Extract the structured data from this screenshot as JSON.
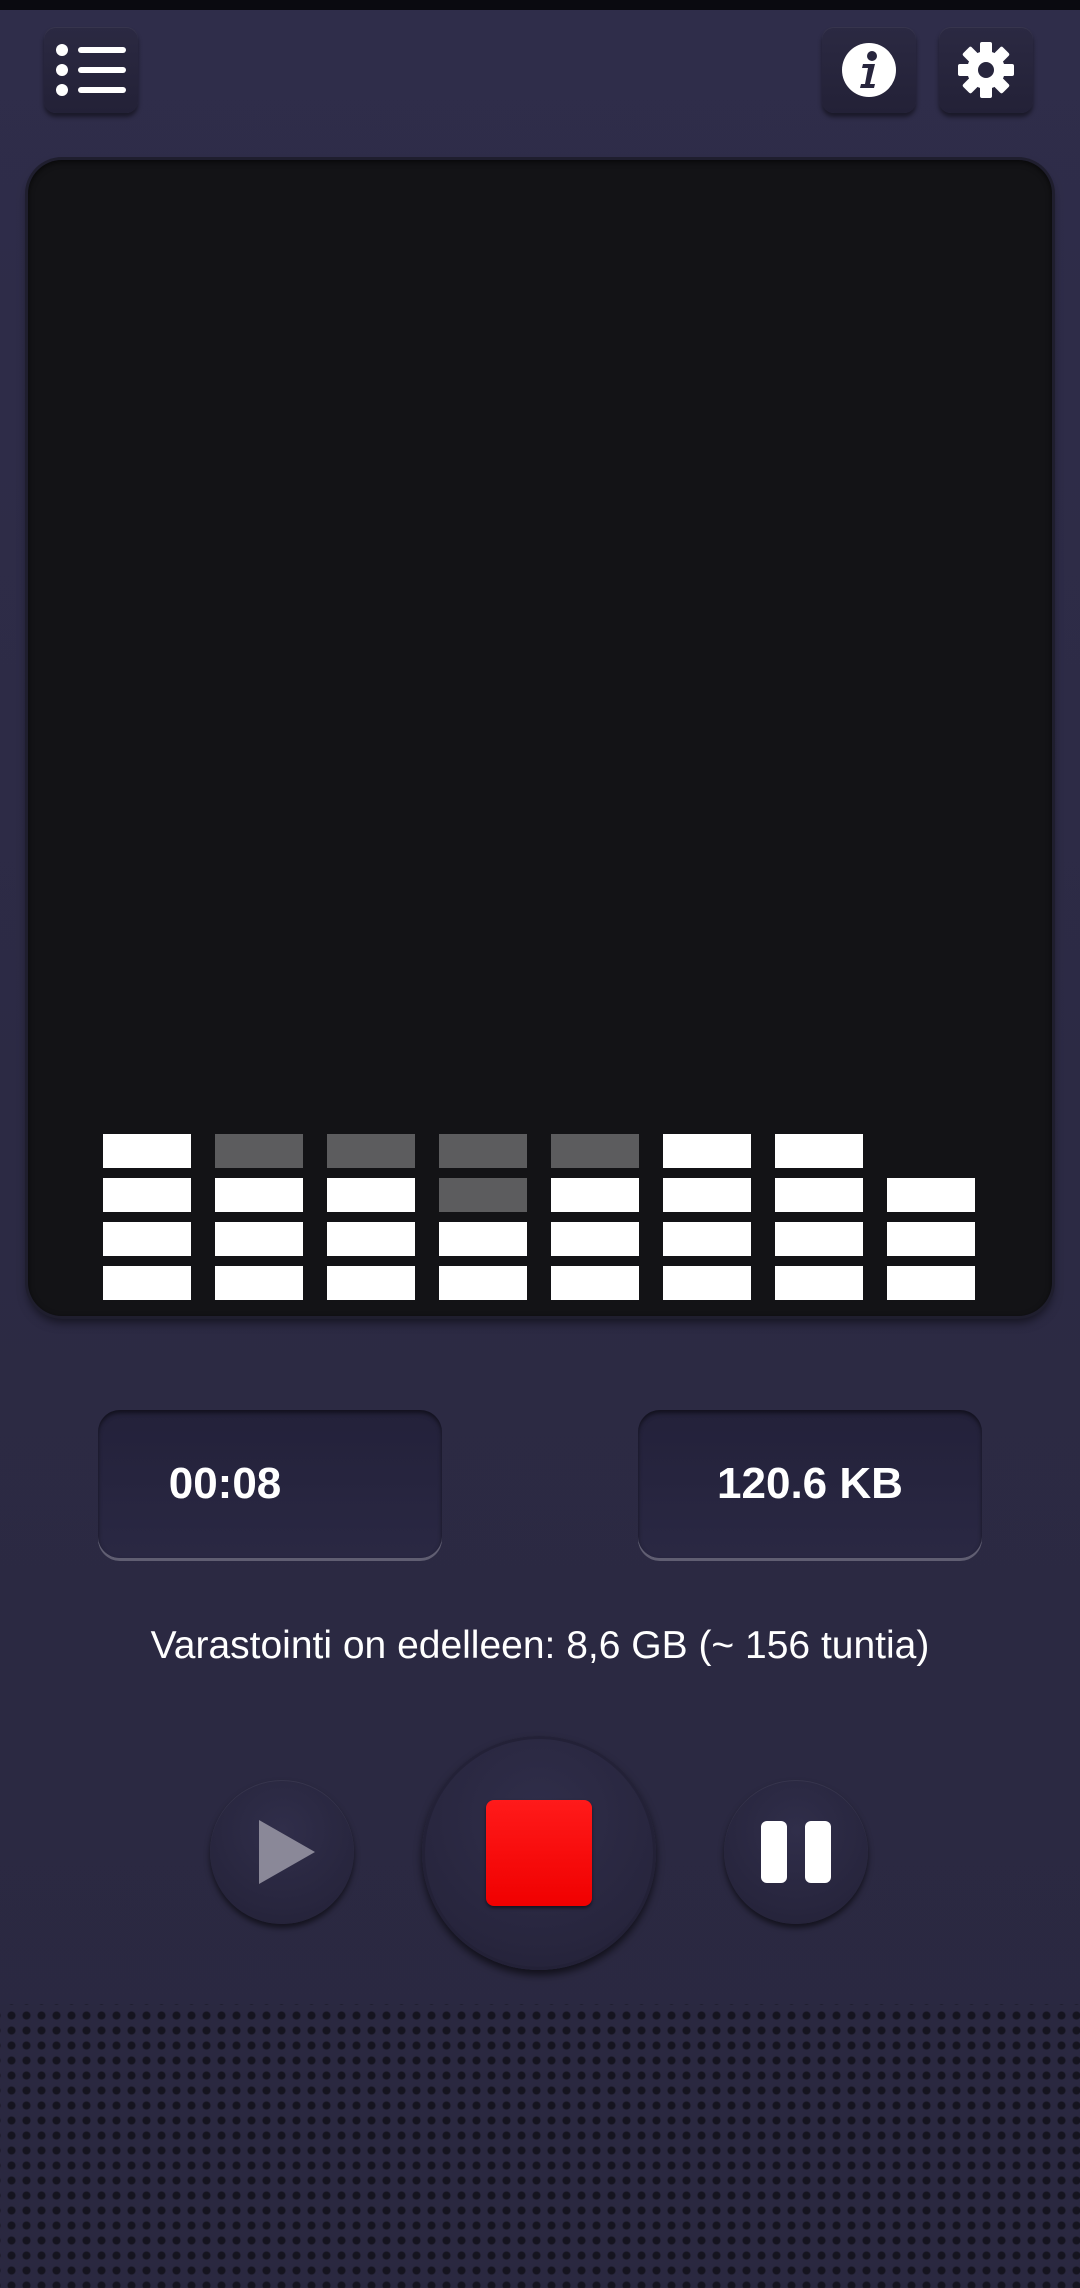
{
  "toolbar": {
    "menu_icon": "list-menu-icon",
    "info_icon": "info-icon",
    "settings_icon": "gear-icon"
  },
  "visualizer": {
    "levels": [
      {
        "active": 4,
        "dim": 0
      },
      {
        "active": 3,
        "dim": 1
      },
      {
        "active": 3,
        "dim": 1
      },
      {
        "active": 2,
        "dim": 2
      },
      {
        "active": 3,
        "dim": 1
      },
      {
        "active": 4,
        "dim": 0
      },
      {
        "active": 4,
        "dim": 0
      },
      {
        "active": 3,
        "dim": 0
      }
    ],
    "colors": {
      "active": "#ffffff",
      "dim": "#5c5c5e",
      "background": "#131316"
    }
  },
  "readouts": {
    "elapsed_time": "00:08",
    "file_size": "120.6 KB"
  },
  "storage": {
    "remaining_text": "Varastointi on edelleen: 8,6 GB (~ 156 tuntia)"
  },
  "controls": {
    "play_icon": "play-icon",
    "stop_icon": "stop-icon",
    "pause_icon": "pause-icon",
    "stop_color": "#ff0000"
  }
}
